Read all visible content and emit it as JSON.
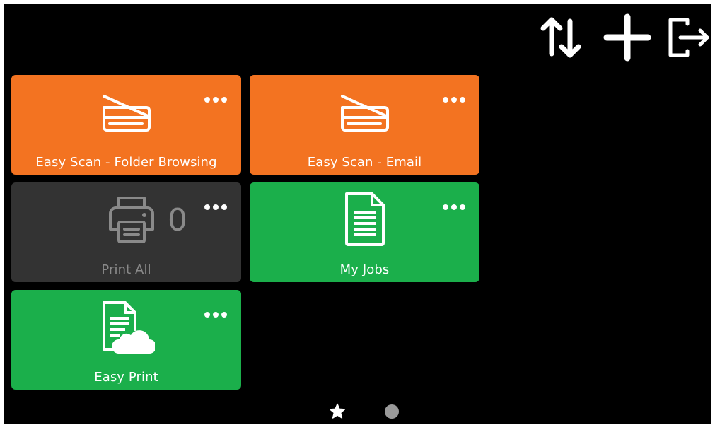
{
  "topbar": {
    "icons": [
      "sort-icon",
      "add-icon",
      "logout-icon"
    ]
  },
  "tiles": [
    {
      "label": "Easy Scan - Folder Browsing",
      "icon": "scanner-icon",
      "color": "#F37321"
    },
    {
      "label": "Easy Scan - Email",
      "icon": "scanner-icon",
      "color": "#F37321"
    },
    {
      "label": "Print All",
      "icon": "printer-icon",
      "color": "#333333",
      "count": "0"
    },
    {
      "label": "My Jobs",
      "icon": "document-icon",
      "color": "#1BAF4B"
    },
    {
      "label": "Easy Print",
      "icon": "cloud-document-icon",
      "color": "#1BAF4B"
    }
  ],
  "pager": {
    "items": [
      "favorites-star-icon",
      "page-dot-icon"
    ]
  },
  "colors": {
    "background": "#000000",
    "orange": "#F37321",
    "green": "#1BAF4B",
    "dark": "#333333"
  }
}
